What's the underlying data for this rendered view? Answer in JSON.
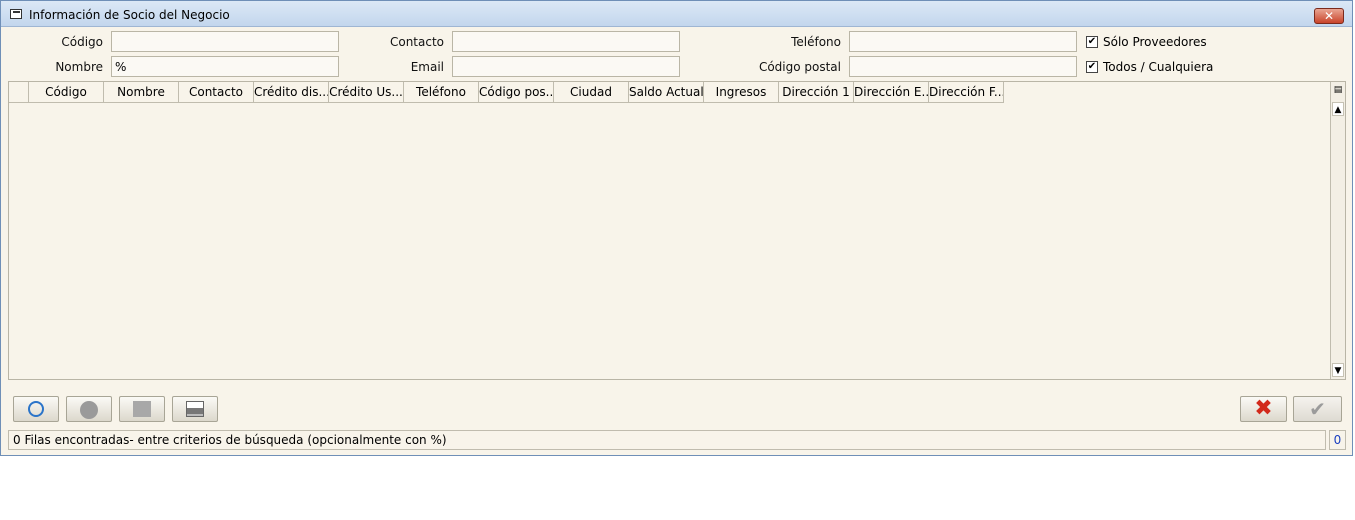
{
  "window": {
    "title": "Información de Socio del Negocio",
    "close_glyph": "✕"
  },
  "form": {
    "codigo_label": "Código",
    "codigo_value": "",
    "nombre_label": "Nombre",
    "nombre_value": "%",
    "contacto_label": "Contacto",
    "contacto_value": "",
    "email_label": "Email",
    "email_value": "",
    "telefono_label": "Teléfono",
    "telefono_value": "",
    "codigo_postal_label": "Código postal",
    "codigo_postal_value": "",
    "solo_proveedores_label": "Sólo Proveedores",
    "solo_proveedores_checked": true,
    "todos_label": "Todos / Cualquiera",
    "todos_checked": true,
    "check_glyph": "✔"
  },
  "grid": {
    "columns": [
      "Código",
      "Nombre",
      "Contacto",
      "Crédito dis...",
      "Crédito Us...",
      "Teléfono",
      "Código pos...",
      "Ciudad",
      "Saldo Actual",
      "Ingresos",
      "Dirección 1",
      "Dirección E...",
      "Dirección F..."
    ],
    "rows": []
  },
  "toolbar": {
    "refresh_icon": "refresh-icon",
    "zoom_icon": "zoom-icon",
    "doc_icon": "document-search-icon",
    "print_icon": "print-icon",
    "cancel_glyph": "✖",
    "ok_glyph": "✔"
  },
  "status": {
    "message": "0 Filas encontradas- entre criterios de búsqueda (opcionalmente con %)",
    "count": "0"
  }
}
